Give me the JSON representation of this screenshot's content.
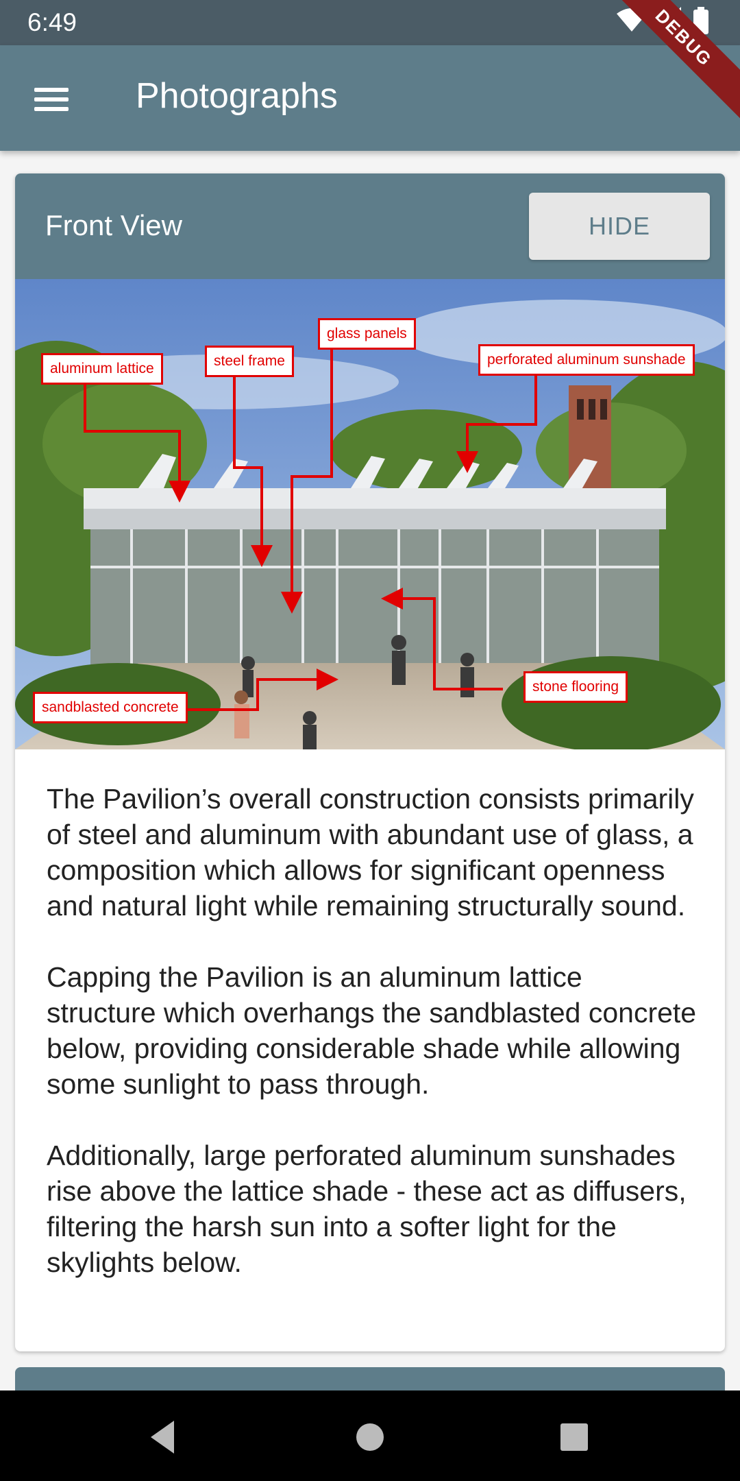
{
  "status_bar": {
    "time": "6:49",
    "icons": [
      "wifi-icon",
      "signal-icon",
      "battery-icon"
    ]
  },
  "debug_banner": "DEBUG",
  "app_bar": {
    "title": "Photographs",
    "menu_icon": "menu-icon"
  },
  "card": {
    "title": "Front View",
    "hide_label": "HIDE",
    "photo_labels": {
      "aluminum_lattice": "aluminum lattice",
      "steel_frame": "steel frame",
      "glass_panels": "glass panels",
      "sunshade": "perforated aluminum sunshade",
      "sandblasted_concrete": "sandblasted concrete",
      "stone_flooring": "stone flooring"
    },
    "paragraphs": [
      "The Pavilion’s overall construction consists primarily of steel and aluminum with abundant use of glass, a composition which allows for significant openness and natural light while remaining structurally sound.",
      "Capping the Pavilion is an aluminum lattice structure which overhangs the sandblasted concrete below, providing considerable shade while allowing some sunlight to pass through.",
      "Additionally, large perforated aluminum sunshades rise above the lattice shade - these act as diffusers, filtering the harsh sun into a softer light for the skylights below."
    ]
  },
  "nav_bar": {
    "back": "back-icon",
    "home": "home-icon",
    "recents": "recents-icon"
  },
  "colors": {
    "app_bar": "#5e7d8a",
    "status_bar": "#4b5c66",
    "annotation": "#e10000",
    "debug": "#8b1d1d"
  }
}
